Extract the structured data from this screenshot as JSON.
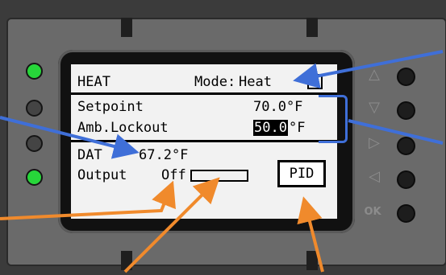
{
  "display": {
    "header": {
      "menu": "HEAT",
      "mode_label": "Mode:",
      "mode_value": "Heat",
      "close_glyph": "✕"
    },
    "setpoint": {
      "label": "Setpoint",
      "value": "70.0°F"
    },
    "amb_lockout": {
      "label": "Amb.Lockout",
      "value_highlight": "50.0",
      "unit": "°F"
    },
    "dat": {
      "label": "DAT",
      "value": "67.2°F"
    },
    "output": {
      "label": "Output",
      "value": "Off",
      "level_fraction": 0
    },
    "pid_button": "PID"
  },
  "nav_buttons": {
    "up": "△",
    "down": "▽",
    "right": "▷",
    "left": "◁",
    "ok": "OK"
  },
  "leds": [
    {
      "name": "led-1",
      "color": "#27d63a",
      "on": true
    },
    {
      "name": "led-2",
      "color": "#444444",
      "on": false
    },
    {
      "name": "led-3",
      "color": "#444444",
      "on": false
    },
    {
      "name": "led-4",
      "color": "#27d63a",
      "on": true
    }
  ],
  "colors": {
    "blue_callout": "#3f6fd8",
    "orange_callout": "#f08a2c",
    "lcd_background": "#f2f2f2"
  }
}
